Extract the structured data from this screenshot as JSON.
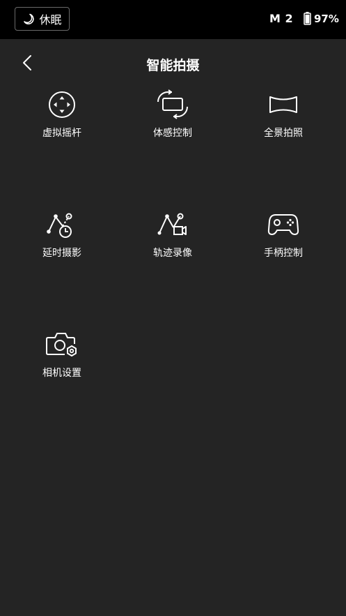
{
  "status_bar": {
    "sleep_label": "休眠",
    "device_name": "M 2",
    "battery_percent": "97%",
    "battery_level": 0.97
  },
  "header": {
    "title": "智能拍摄"
  },
  "features": [
    {
      "label": "虚拟摇杆",
      "icon": "virtual-joystick-icon"
    },
    {
      "label": "体感控制",
      "icon": "motion-control-icon"
    },
    {
      "label": "全景拍照",
      "icon": "panorama-icon"
    },
    {
      "label": "延时摄影",
      "icon": "timelapse-icon"
    },
    {
      "label": "轨迹录像",
      "icon": "trajectory-recording-icon"
    },
    {
      "label": "手柄控制",
      "icon": "gamepad-icon"
    },
    {
      "label": "相机设置",
      "icon": "camera-settings-icon"
    }
  ],
  "colors": {
    "background": "#242424",
    "status_bar": "#000000",
    "foreground": "#ffffff"
  }
}
